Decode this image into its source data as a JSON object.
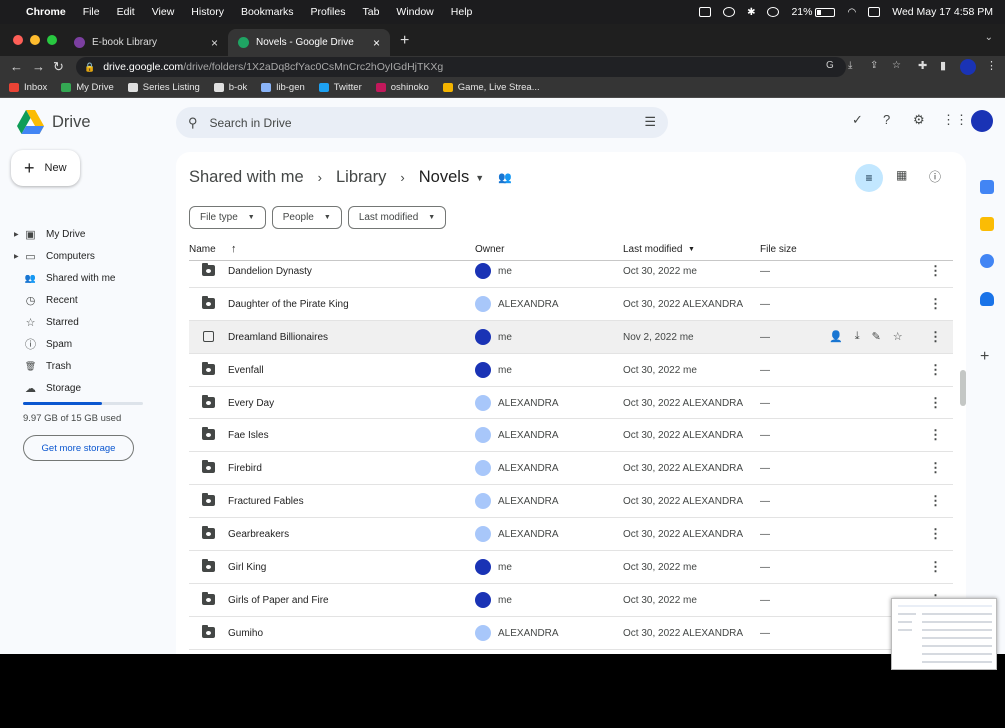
{
  "menubar": {
    "app": "Chrome",
    "items": [
      "File",
      "Edit",
      "View",
      "History",
      "Bookmarks",
      "Profiles",
      "Tab",
      "Window",
      "Help"
    ],
    "battery": "21%",
    "datetime": "Wed May 17  4:58 PM"
  },
  "tabs": [
    {
      "title": "E-book Library",
      "favicon_color": "#7b3fa0"
    },
    {
      "title": "Novels - Google Drive",
      "favicon_color": "#1fa463"
    }
  ],
  "address": {
    "host": "drive.google.com",
    "path": "/drive/folders/1X2aDq8cfYac0CsMnCrc2hOyIGdHjTKXg"
  },
  "bookmarks": [
    {
      "label": "Inbox",
      "color": "#ea4335"
    },
    {
      "label": "My Drive",
      "color": "#34a853"
    },
    {
      "label": "Series Listing",
      "color": "#e0e0e0"
    },
    {
      "label": "b-ok",
      "color": "#e0e0e0"
    },
    {
      "label": "lib-gen",
      "color": "#8ab4f8"
    },
    {
      "label": "Twitter",
      "color": "#1da1f2"
    },
    {
      "label": "oshinoko",
      "color": "#c2185b"
    },
    {
      "label": "Game, Live Strea...",
      "color": "#f4b400"
    }
  ],
  "drive": {
    "title": "Drive",
    "search_placeholder": "Search in Drive",
    "new_label": "New",
    "nav": [
      {
        "label": "My Drive",
        "icon": "my-drive-icon",
        "glyph": "▣",
        "expandable": true
      },
      {
        "label": "Computers",
        "icon": "computer-icon",
        "glyph": "▭",
        "expandable": true
      },
      {
        "label": "Shared with me",
        "icon": "shared-icon",
        "glyph": "👥",
        "expandable": false
      },
      {
        "label": "Recent",
        "icon": "clock-icon",
        "glyph": "◷",
        "expandable": false
      },
      {
        "label": "Starred",
        "icon": "star-icon",
        "glyph": "☆",
        "expandable": false
      },
      {
        "label": "Spam",
        "icon": "spam-icon",
        "glyph": "ⓘ",
        "expandable": false
      },
      {
        "label": "Trash",
        "icon": "trash-icon",
        "glyph": "🗑",
        "expandable": false
      },
      {
        "label": "Storage",
        "icon": "cloud-icon",
        "glyph": "☁",
        "expandable": false
      }
    ],
    "storage_used_fraction": 0.66,
    "storage_text": "9.97 GB of 15 GB used",
    "get_storage_label": "Get more storage",
    "breadcrumb": {
      "first": "Shared with me",
      "second": "Library",
      "current": "Novels"
    },
    "filters": [
      "File type",
      "People",
      "Last modified"
    ],
    "columns": {
      "name": "Name",
      "owner": "Owner",
      "modified": "Last modified",
      "size": "File size"
    },
    "rows": [
      {
        "name": "Dandelion Dynasty",
        "owner": "me",
        "modified": "Oct 30, 2022 me",
        "size": "—",
        "type": "shared-folder"
      },
      {
        "name": "Daughter of the Pirate King",
        "owner": "ALEXANDRA",
        "modified": "Oct 30, 2022 ALEXANDRA",
        "size": "—",
        "type": "shared-folder"
      },
      {
        "name": "Dreamland Billionaires",
        "owner": "me",
        "modified": "Nov 2, 2022 me",
        "size": "—",
        "type": "selected"
      },
      {
        "name": "Evenfall",
        "owner": "me",
        "modified": "Oct 30, 2022 me",
        "size": "—",
        "type": "shared-folder"
      },
      {
        "name": "Every Day",
        "owner": "ALEXANDRA",
        "modified": "Oct 30, 2022 ALEXANDRA",
        "size": "—",
        "type": "shared-folder"
      },
      {
        "name": "Fae Isles",
        "owner": "ALEXANDRA",
        "modified": "Oct 30, 2022 ALEXANDRA",
        "size": "—",
        "type": "shared-folder"
      },
      {
        "name": "Firebird",
        "owner": "ALEXANDRA",
        "modified": "Oct 30, 2022 ALEXANDRA",
        "size": "—",
        "type": "shared-folder"
      },
      {
        "name": "Fractured Fables",
        "owner": "ALEXANDRA",
        "modified": "Oct 30, 2022 ALEXANDRA",
        "size": "—",
        "type": "shared-folder"
      },
      {
        "name": "Gearbreakers",
        "owner": "ALEXANDRA",
        "modified": "Oct 30, 2022 ALEXANDRA",
        "size": "—",
        "type": "shared-folder"
      },
      {
        "name": "Girl King",
        "owner": "me",
        "modified": "Oct 30, 2022 me",
        "size": "—",
        "type": "shared-folder"
      },
      {
        "name": "Girls of Paper and Fire",
        "owner": "me",
        "modified": "Oct 30, 2022 me",
        "size": "—",
        "type": "shared-folder"
      },
      {
        "name": "Gumiho",
        "owner": "ALEXANDRA",
        "modified": "Oct 30, 2022 ALEXANDRA",
        "size": "—",
        "type": "shared-folder"
      }
    ],
    "owner_colors": {
      "me": "#1a33b5",
      "ALEXANDRA": "#a8c7fa"
    }
  }
}
